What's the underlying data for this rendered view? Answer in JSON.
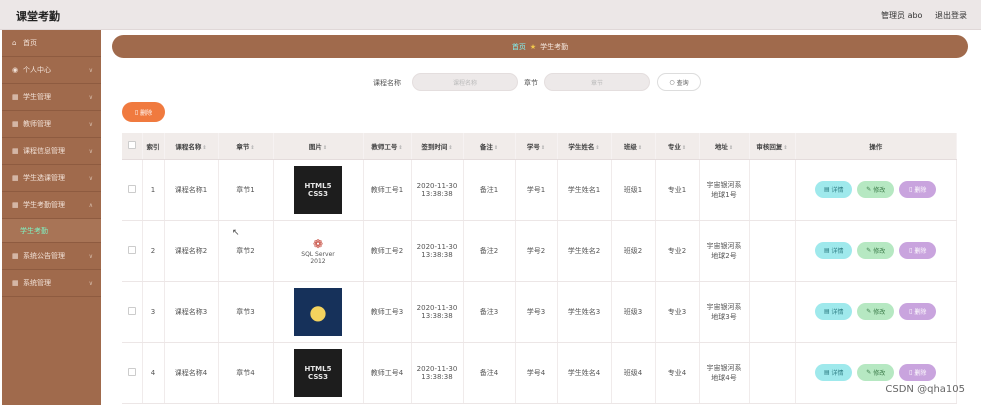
{
  "app": {
    "title": "课堂考勤"
  },
  "topbar": {
    "user": "管理员 abo",
    "logout": "退出登录"
  },
  "sidebar": {
    "items": [
      {
        "label": "首页",
        "icon": "home-icon",
        "glyph": "⌂"
      },
      {
        "label": "个人中心",
        "icon": "user-icon",
        "glyph": "👤"
      },
      {
        "label": "学生管理",
        "icon": "grid-icon",
        "glyph": "▦"
      },
      {
        "label": "教师管理",
        "icon": "grid-icon",
        "glyph": "▦"
      },
      {
        "label": "课程信息管理",
        "icon": "grid-icon",
        "glyph": "▦"
      },
      {
        "label": "学生选课管理",
        "icon": "grid-icon",
        "glyph": "▦"
      },
      {
        "label": "学生考勤管理",
        "icon": "grid-icon",
        "glyph": "▦"
      }
    ],
    "sub_item": "学生考勤",
    "items_after": [
      {
        "label": "系统公告管理",
        "icon": "grid-icon",
        "glyph": "▦"
      },
      {
        "label": "系统管理",
        "icon": "grid-icon",
        "glyph": "▦"
      }
    ]
  },
  "breadcrumb": {
    "home": "首页",
    "current": "学生考勤"
  },
  "search": {
    "course_label": "课程名称",
    "course_placeholder": "课程名称",
    "chapter_label": "章节",
    "chapter_placeholder": "章节",
    "query_button": "查询"
  },
  "toolbar": {
    "delete_label": "删除"
  },
  "table": {
    "headers": [
      "索引",
      "课程名称",
      "章节",
      "图片",
      "教师工号",
      "签到时间",
      "备注",
      "学号",
      "学生姓名",
      "班级",
      "专业",
      "地址",
      "审核回复",
      "操作"
    ],
    "rows": [
      {
        "index": "1",
        "course": "课程名称1",
        "chapter": "章节1",
        "image": "HTML5 CSS3",
        "teacher": "教师工号1",
        "date": "2020-11-30",
        "time": "13:38:38",
        "note": "备注1",
        "sid": "学号1",
        "sname": "学生姓名1",
        "class": "班级1",
        "major": "专业1",
        "addr1": "宇宙银河系",
        "addr2": "地球1号",
        "reply": ""
      },
      {
        "index": "2",
        "course": "课程名称2",
        "chapter": "章节2",
        "image": "SQL Server 2012",
        "teacher": "教师工号2",
        "date": "2020-11-30",
        "time": "13:38:38",
        "note": "备注2",
        "sid": "学号2",
        "sname": "学生姓名2",
        "class": "班级2",
        "major": "专业2",
        "addr1": "宇宙银河系",
        "addr2": "地球2号",
        "reply": ""
      },
      {
        "index": "3",
        "course": "课程名称3",
        "chapter": "章节3",
        "image": "",
        "teacher": "教师工号3",
        "date": "2020-11-30",
        "time": "13:38:38",
        "note": "备注3",
        "sid": "学号3",
        "sname": "学生姓名3",
        "class": "班级3",
        "major": "专业3",
        "addr1": "宇宙银河系",
        "addr2": "地球3号",
        "reply": ""
      },
      {
        "index": "4",
        "course": "课程名称4",
        "chapter": "章节4",
        "image": "HTML5 CSS3",
        "teacher": "教师工号4",
        "date": "2020-11-30",
        "time": "13:38:38",
        "note": "备注4",
        "sid": "学号4",
        "sname": "学生姓名4",
        "class": "班级4",
        "major": "专业4",
        "addr1": "宇宙银河系",
        "addr2": "地球4号",
        "reply": ""
      }
    ],
    "ops": {
      "detail": "详情",
      "edit": "修改",
      "remove": "删除"
    }
  },
  "watermark": "CSDN @qha105",
  "colors": {
    "brand": "#a06a4c",
    "accent": "#f07a3f",
    "active": "#7ff3c3"
  }
}
